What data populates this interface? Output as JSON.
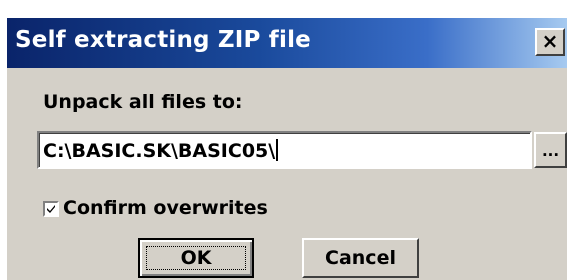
{
  "dialog": {
    "title": "Self extracting ZIP file",
    "close_label": "×",
    "unpack_label": "Unpack all files to:",
    "path_value": "C:\\BASIC.SK\\BASIC05\\",
    "browse_label": "...",
    "confirm_label": "Confirm overwrites",
    "confirm_checked": true,
    "ok_label": "OK",
    "cancel_label": "Cancel"
  },
  "colors": {
    "titlebar_start": "#0a246a",
    "titlebar_end": "#a6caf0",
    "face": "#d4d0c8"
  }
}
